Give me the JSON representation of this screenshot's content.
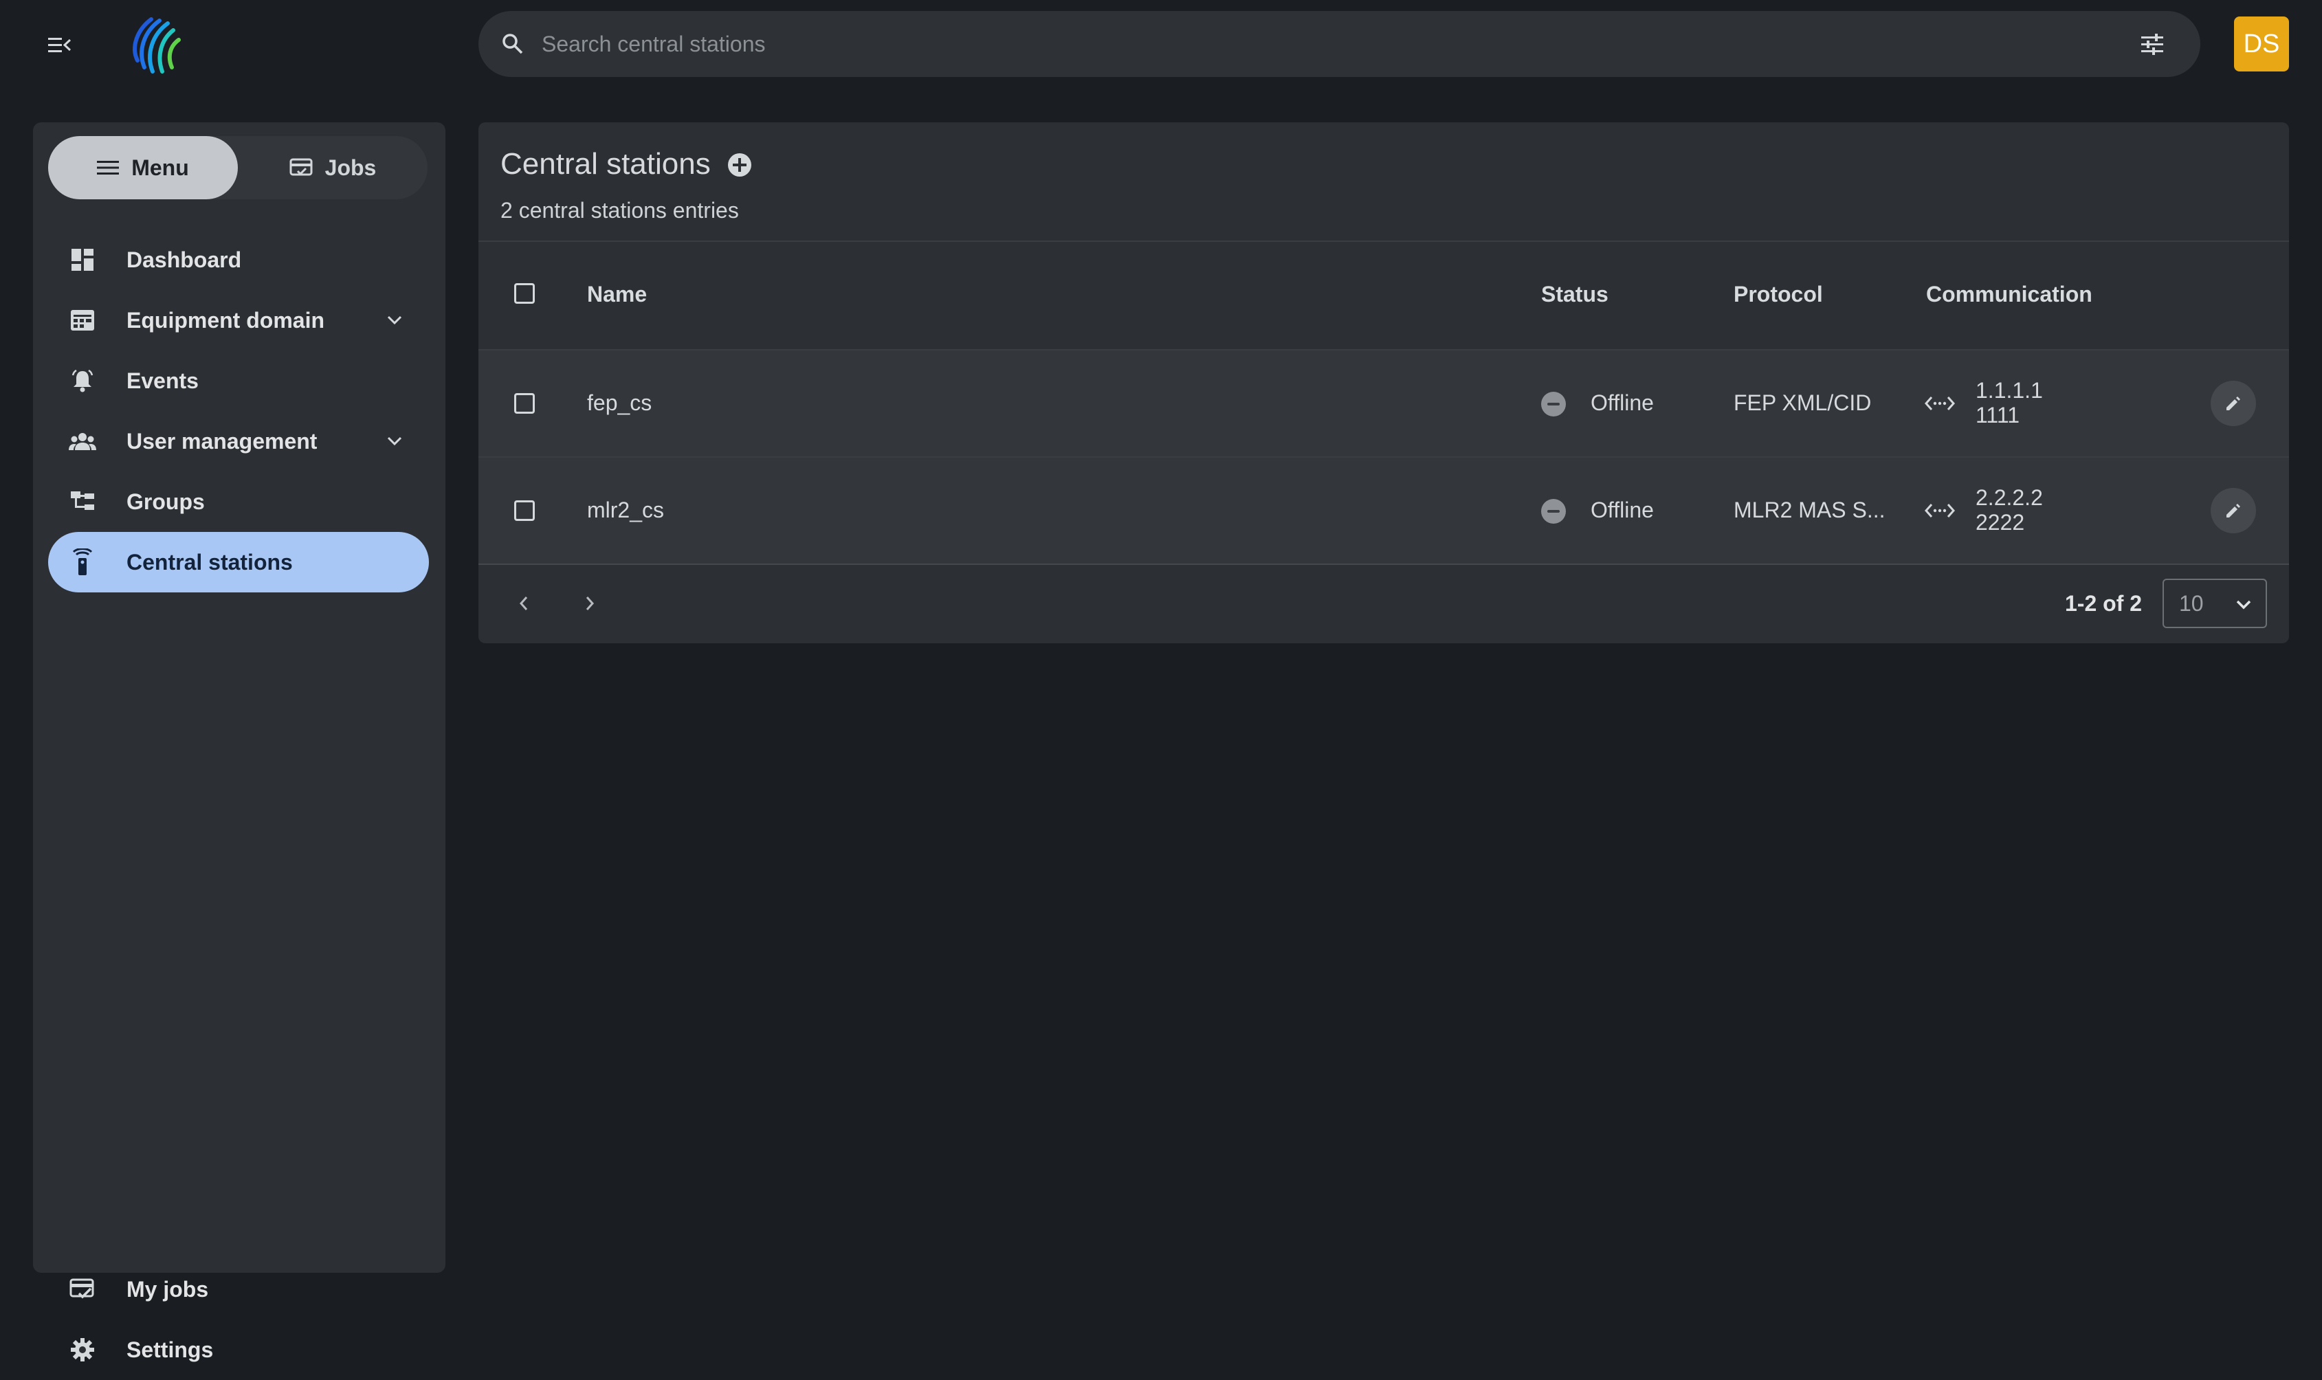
{
  "topbar": {
    "search_placeholder": "Search central stations",
    "avatar_initials": "DS",
    "avatar_color": "#e8a715"
  },
  "sidebar": {
    "toggle": {
      "menu_label": "Menu",
      "jobs_label": "Jobs",
      "active": "Menu"
    },
    "items": [
      {
        "label": "Dashboard",
        "icon": "dashboard-icon"
      },
      {
        "label": "Equipment domain",
        "icon": "equipment-icon",
        "expandable": true
      },
      {
        "label": "Events",
        "icon": "bell-icon"
      },
      {
        "label": "User management",
        "icon": "users-icon",
        "expandable": true
      },
      {
        "label": "Groups",
        "icon": "groups-icon"
      },
      {
        "label": "Central stations",
        "icon": "central-station-icon",
        "active": true
      }
    ],
    "bottom_items": [
      {
        "label": "My jobs",
        "icon": "my-jobs-icon"
      },
      {
        "label": "Settings",
        "icon": "gear-icon"
      }
    ],
    "active_color": "#a9c7f5"
  },
  "main": {
    "title": "Central stations",
    "subtitle": "2 central stations entries",
    "columns": [
      "Name",
      "Status",
      "Protocol",
      "Communication"
    ],
    "rows": [
      {
        "name": "fep_cs",
        "status": "Offline",
        "protocol": "FEP XML/CID",
        "comm_line1": "1.1.1.1",
        "comm_line2": "1111"
      },
      {
        "name": "mlr2_cs",
        "status": "Offline",
        "protocol": "MLR2 MAS S...",
        "comm_line1": "2.2.2.2",
        "comm_line2": "2222"
      }
    ],
    "pagination": {
      "range": "1-2 of 2",
      "page_size": "10"
    }
  }
}
